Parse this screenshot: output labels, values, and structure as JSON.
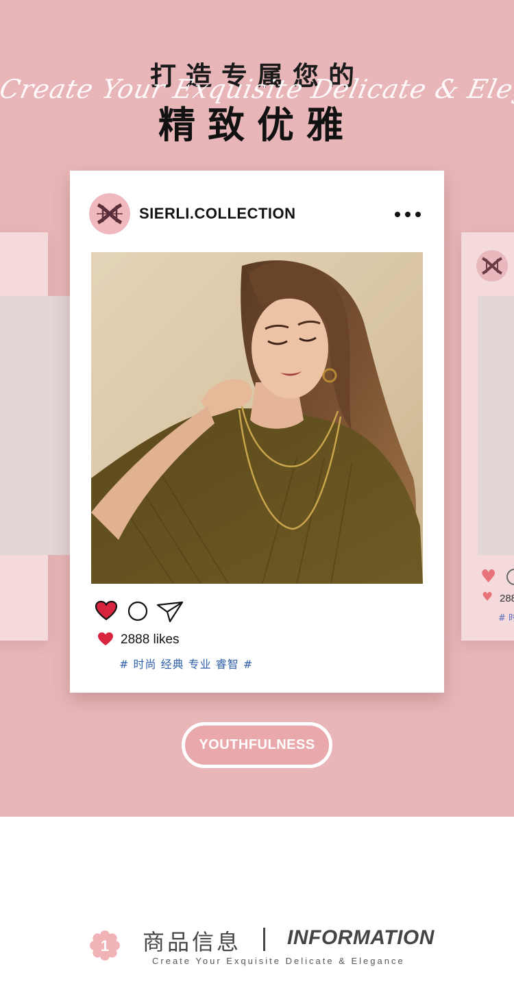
{
  "hero": {
    "title_top": "打造专属您的",
    "title_script": "Create Your Exquisite Delicate & Elegance",
    "title_main": "精致优雅",
    "background_color": "#e8b6b8"
  },
  "post": {
    "username": "SIERLI.COLLECTION",
    "more_icon": "more-dots-icon",
    "likes": "2888 likes",
    "tags": "# 时尚 经典 专业 睿智 #",
    "like_color": "#d8253f",
    "tag_color": "#2e5fa8"
  },
  "side_card_right": {
    "likes": "288",
    "tags": "# 时"
  },
  "cta": {
    "label": "YOUTHFULNESS"
  },
  "section": {
    "number": "1",
    "title_cn": "商品信息",
    "title_en": "INFORMATION",
    "subtitle": "Create Your Exquisite Delicate & Elegance"
  }
}
